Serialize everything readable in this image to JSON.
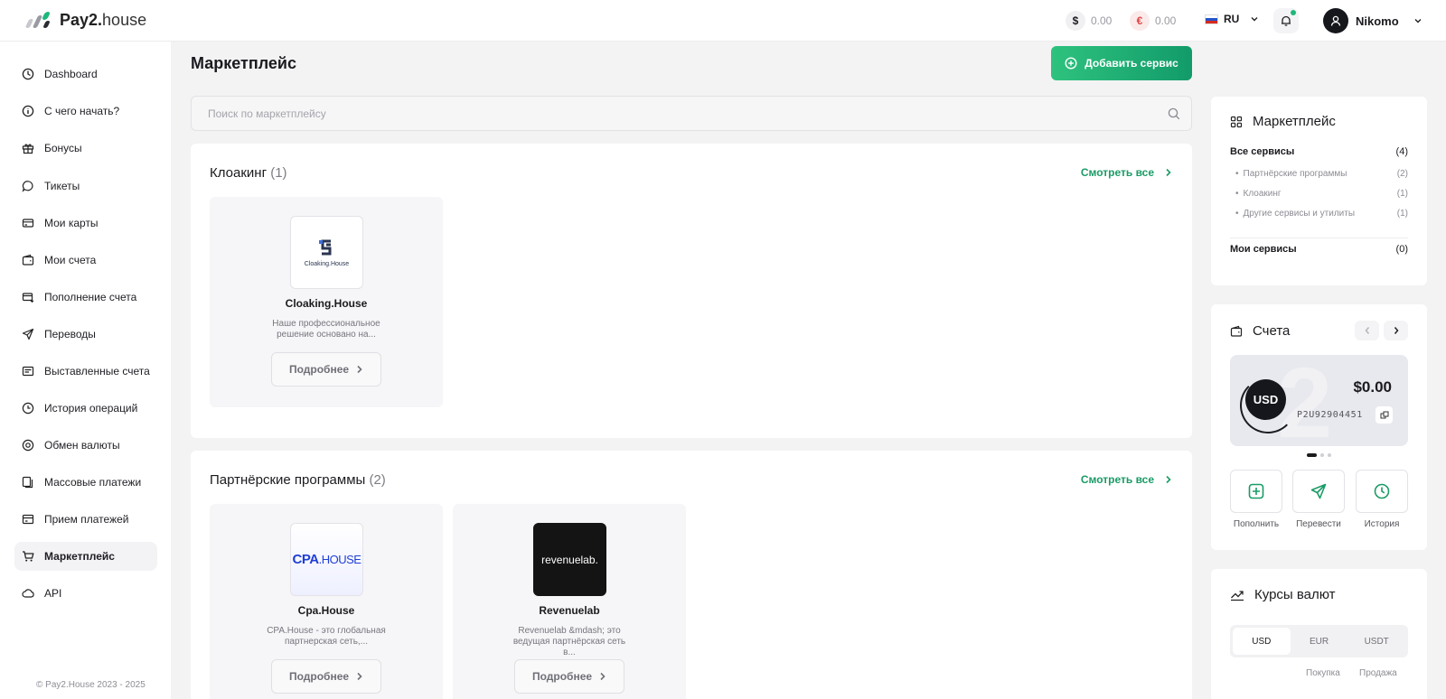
{
  "header": {
    "logo_main": "Pay2.",
    "logo_sub": "house",
    "balance_usd": "0.00",
    "balance_eur": "0.00",
    "usd_symbol": "$",
    "eur_symbol": "€",
    "language": "RU",
    "user_name": "Nikomo"
  },
  "sidebar": {
    "items": [
      {
        "label": "Dashboard",
        "icon": "dashboard-icon"
      },
      {
        "label": "С чего начать?",
        "icon": "info-icon"
      },
      {
        "label": "Бонусы",
        "icon": "gift-icon"
      },
      {
        "label": "Тикеты",
        "icon": "chat-icon"
      },
      {
        "label": "Мои карты",
        "icon": "card-icon"
      },
      {
        "label": "Мои счета",
        "icon": "wallet-icon"
      },
      {
        "label": "Пополнение счета",
        "icon": "topup-icon"
      },
      {
        "label": "Переводы",
        "icon": "send-icon"
      },
      {
        "label": "Выставленные счета",
        "icon": "invoice-icon"
      },
      {
        "label": "История операций",
        "icon": "history-icon"
      },
      {
        "label": "Обмен валюты",
        "icon": "exchange-icon"
      },
      {
        "label": "Массовые платежи",
        "icon": "mass-payment-icon"
      },
      {
        "label": "Прием платежей",
        "icon": "accept-payment-icon"
      },
      {
        "label": "Маркетплейс",
        "icon": "cart-icon"
      },
      {
        "label": "API",
        "icon": "cloud-icon"
      }
    ],
    "active_index": 13,
    "copyright": "© Pay2.House 2023 - 2025"
  },
  "main": {
    "title": "Маркетплейс",
    "add_button": "Добавить сервис",
    "search_placeholder": "Поиск по маркетплейсу",
    "sections": [
      {
        "title": "Клоакинг",
        "count": "(1)",
        "see_all": "Смотреть все",
        "cards": [
          {
            "name": "Cloaking.House",
            "logo_text": "Cloaking.House",
            "desc": "Наше профессиональное решение основано на...",
            "button": "Подробнее"
          }
        ]
      },
      {
        "title": "Партнёрские программы",
        "count": "(2)",
        "see_all": "Смотреть все",
        "cards": [
          {
            "name": "Cpa.House",
            "logo_text_a": "CPA",
            "logo_text_b": ".HOUSE",
            "desc": "CPA.House - это глобальная партнерская сеть,...",
            "button": "Подробнее"
          },
          {
            "name": "Revenuelab",
            "logo_text": "revenuelab.",
            "desc": "Revenuelab &mdash; это ведущая партнёрская сеть в...",
            "button": "Подробнее"
          }
        ]
      }
    ]
  },
  "marketplace_panel": {
    "title": "Маркетплейс",
    "all_services": {
      "label": "Все сервисы",
      "count": "(4)"
    },
    "categories": [
      {
        "label": "Партнёрские программы",
        "count": "(2)"
      },
      {
        "label": "Клоакинг",
        "count": "(1)"
      },
      {
        "label": "Другие сервисы и утилиты",
        "count": "(1)"
      }
    ],
    "my_services": {
      "label": "Мои сервисы",
      "count": "(0)"
    }
  },
  "accounts_panel": {
    "title": "Счета",
    "currency": "USD",
    "amount": "$0.00",
    "account_number": "P2U92904451",
    "bg_digit": "2",
    "actions": [
      "Пополнить",
      "Перевести",
      "История"
    ]
  },
  "rates_panel": {
    "title": "Курсы валют",
    "tabs": [
      "USD",
      "EUR",
      "USDT"
    ],
    "active_tab": 0,
    "col_buy": "Покупка",
    "col_sell": "Продажа"
  },
  "colors": {
    "accent": "#1a9b66",
    "button_gradient_start": "#2ec27e",
    "button_gradient_end": "#129b6a",
    "notification_dot": "#1fb77a"
  }
}
